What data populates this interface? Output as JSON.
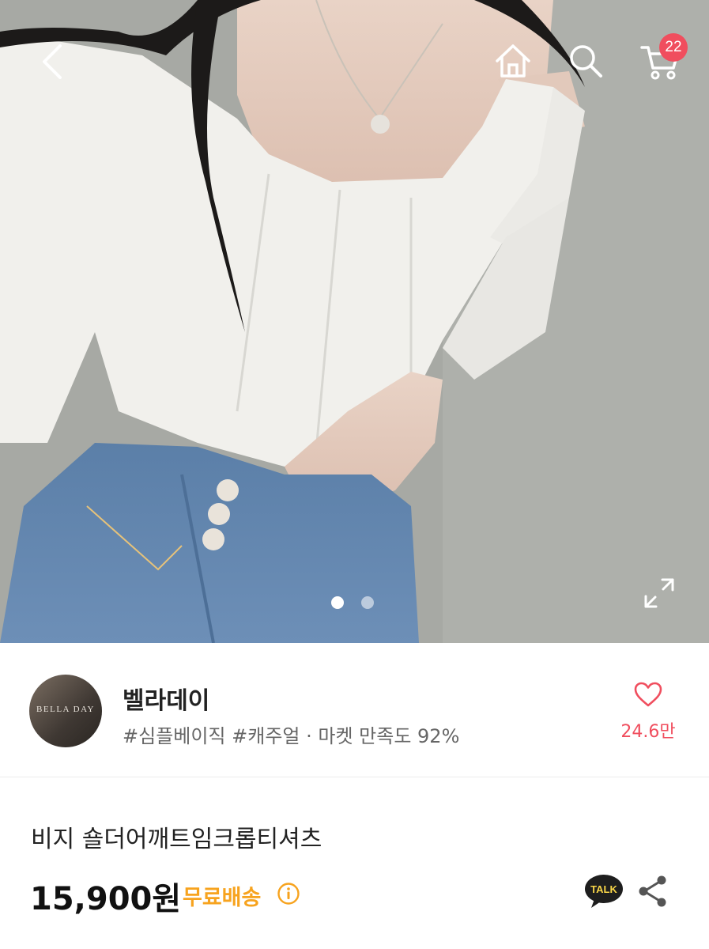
{
  "header": {
    "back_icon": "chevron-left-icon",
    "home_icon": "home-icon",
    "search_icon": "search-icon",
    "cart_icon": "cart-icon",
    "cart_count": "22"
  },
  "gallery": {
    "expand_icon": "expand-icon",
    "current_slide": 1,
    "total_slides": 2
  },
  "seller": {
    "avatar_text": "BELLA DAY",
    "name": "벨라데이",
    "tags": "#심플베이직 #캐주얼 · 마켓 만족도 92%",
    "like_count": "24.6만"
  },
  "product": {
    "title": "비지 숄더어깨트임크롭티셔츠",
    "price": "15,900원",
    "shipping": "무료배송",
    "talk_label": "TALK"
  },
  "colors": {
    "accent_red": "#f04e5e",
    "shipping_orange": "#f7a31e"
  }
}
